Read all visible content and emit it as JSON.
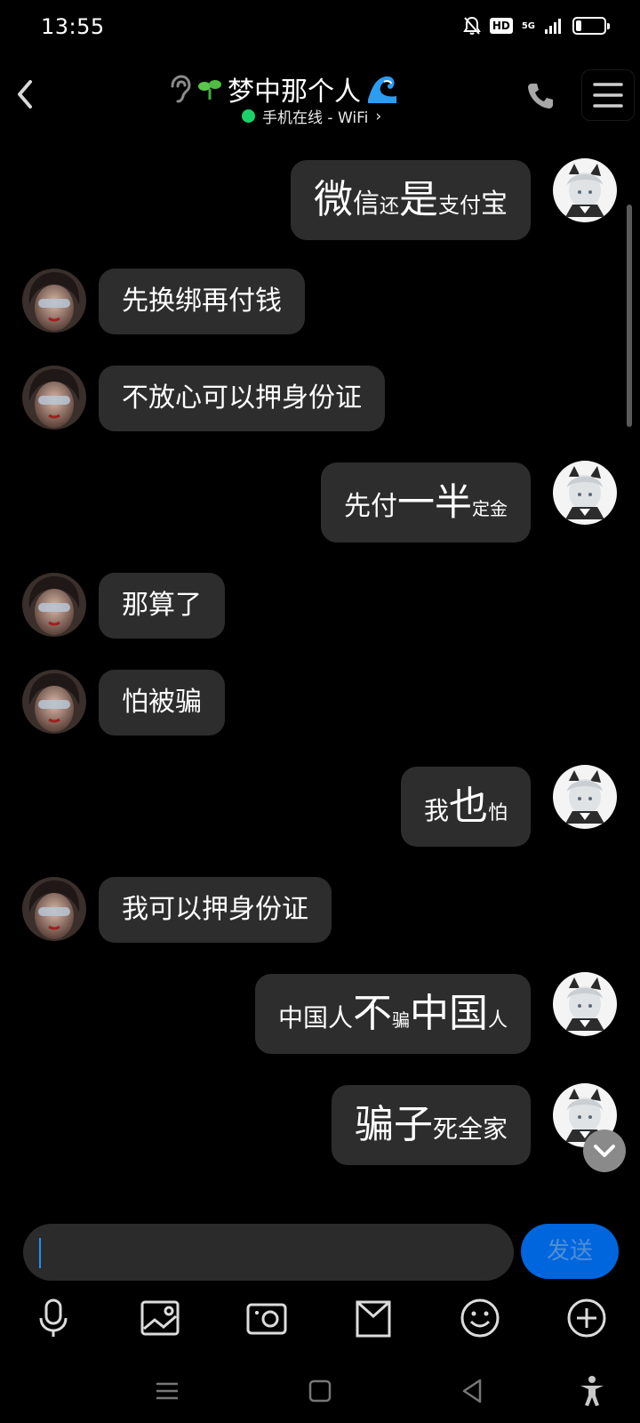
{
  "status_bar": {
    "time": "13:55",
    "hd_label": "HD",
    "network_label": "5G",
    "battery_level": 0.2
  },
  "header": {
    "title": "梦中那个人",
    "online_status": "手机在线 - WiFi",
    "online_chevron": "›"
  },
  "messages": [
    {
      "side": "right",
      "segments": [
        {
          "text": "微",
          "size": 44
        },
        {
          "text": "信",
          "size": 30
        },
        {
          "text": "还",
          "size": 22
        },
        {
          "text": "是",
          "size": 44
        },
        {
          "text": "支付",
          "size": 24
        },
        {
          "text": "宝",
          "size": 30
        }
      ]
    },
    {
      "side": "left",
      "text": "先换绑再付钱"
    },
    {
      "side": "left",
      "text": "不放心可以押身份证"
    },
    {
      "side": "right",
      "segments": [
        {
          "text": "先付",
          "size": 30
        },
        {
          "text": "一半",
          "size": 42
        },
        {
          "text": "定金",
          "size": 20
        }
      ]
    },
    {
      "side": "left",
      "text": "那算了"
    },
    {
      "side": "left",
      "text": "怕被骗"
    },
    {
      "side": "right",
      "segments": [
        {
          "text": "我",
          "size": 28
        },
        {
          "text": "也",
          "size": 44
        },
        {
          "text": "怕",
          "size": 22
        }
      ]
    },
    {
      "side": "left",
      "text": "我可以押身份证"
    },
    {
      "side": "right",
      "segments": [
        {
          "text": "中国人",
          "size": 28
        },
        {
          "text": "不",
          "size": 44
        },
        {
          "text": "骗",
          "size": 20
        },
        {
          "text": "中国",
          "size": 44
        },
        {
          "text": "人",
          "size": 22
        }
      ]
    },
    {
      "side": "right",
      "segments": [
        {
          "text": "骗子",
          "size": 44
        },
        {
          "text": "死全家",
          "size": 28
        }
      ]
    }
  ],
  "composer": {
    "input_value": "",
    "send_label": "发送"
  },
  "colors": {
    "background": "#000000",
    "bubble": "#2d2d2d",
    "online": "#19d36a",
    "send_button": "#0066dd",
    "caret": "#1f8fff"
  },
  "icons": {
    "toolbar": [
      "microphone-icon",
      "image-icon",
      "camera-icon",
      "gift-icon",
      "emoji-icon",
      "plus-icon"
    ],
    "navbar": [
      "menu-icon",
      "home-icon",
      "back-icon",
      "accessibility-icon"
    ]
  }
}
